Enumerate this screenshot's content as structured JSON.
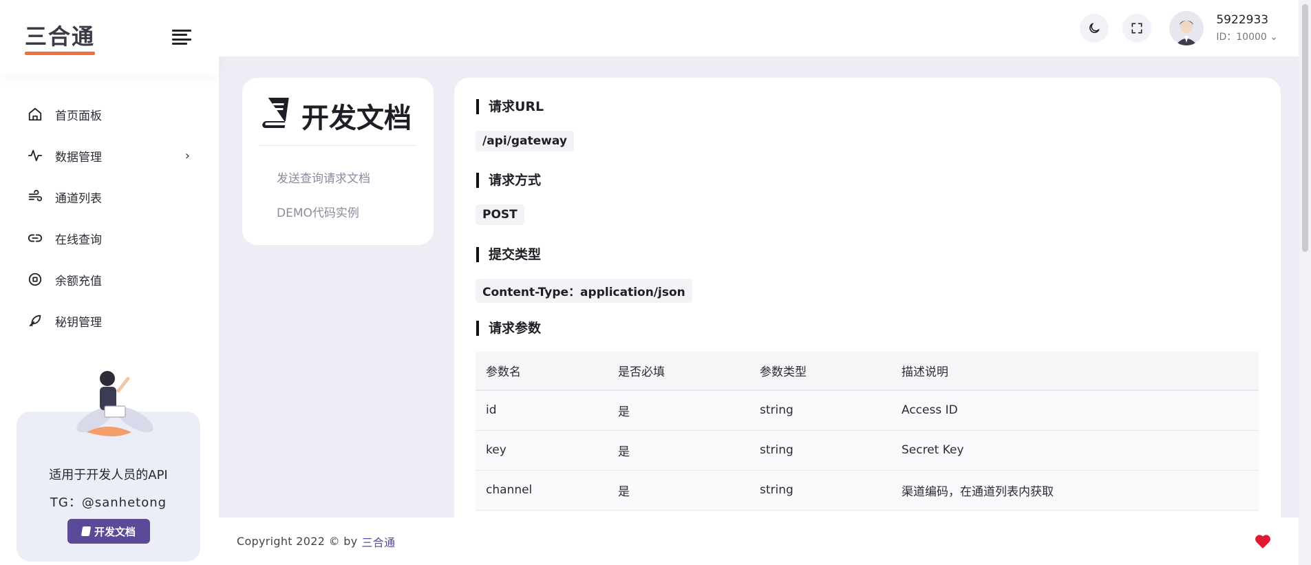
{
  "brand": {
    "logo_text": "三合通"
  },
  "sidebar": {
    "items": [
      {
        "label": "首页面板",
        "icon": "home-icon"
      },
      {
        "label": "数据管理",
        "icon": "activity-icon",
        "has_submenu": true
      },
      {
        "label": "通道列表",
        "icon": "wind-icon"
      },
      {
        "label": "在线查询",
        "icon": "link-icon"
      },
      {
        "label": "余额充值",
        "icon": "coin-icon"
      },
      {
        "label": "秘钥管理",
        "icon": "feather-icon"
      }
    ],
    "promo": {
      "title": "适用于开发人员的API",
      "tg": "TG：@sanhetong",
      "button": "开发文档"
    }
  },
  "header": {
    "username": "5922933",
    "user_id": "ID：10000 ⌄",
    "icons": [
      "moon-icon",
      "fullscreen-icon",
      "avatar"
    ]
  },
  "doc_menu": {
    "title": "开发文档",
    "links": [
      "发送查询请求文档",
      "DEMO代码实例"
    ]
  },
  "doc": {
    "sections": {
      "url_title": "请求URL",
      "url_value": "/api/gateway",
      "method_title": "请求方式",
      "method_value": "POST",
      "ctype_title": "提交类型",
      "ctype_value": "Content-Type：application/json",
      "params_title": "请求参数"
    },
    "table": {
      "headers": [
        "参数名",
        "是否必填",
        "参数类型",
        "描述说明"
      ],
      "rows": [
        [
          "id",
          "是",
          "string",
          "Access ID"
        ],
        [
          "key",
          "是",
          "string",
          "Secret Key"
        ],
        [
          "channel",
          "是",
          "string",
          "渠道编码，在通道列表内获取"
        ]
      ]
    }
  },
  "footer": {
    "copyright": "Copyright 2022 © by",
    "brand": "三合通"
  },
  "colors": {
    "accent": "#5a4a98",
    "logo_underline": "#f06f3b",
    "heart": "#e01b2f",
    "background": "#ecedf5"
  }
}
